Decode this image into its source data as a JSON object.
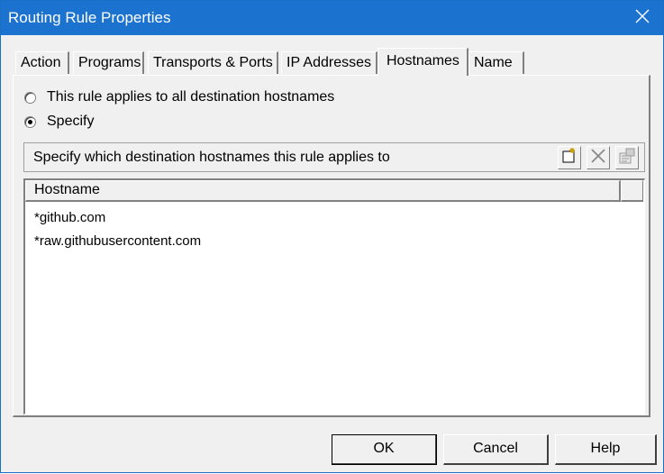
{
  "window": {
    "title": "Routing Rule Properties"
  },
  "tabs": [
    {
      "label": "Action"
    },
    {
      "label": "Programs"
    },
    {
      "label": "Transports & Ports"
    },
    {
      "label": "IP Addresses"
    },
    {
      "label": "Hostnames",
      "active": true
    },
    {
      "label": "Name"
    }
  ],
  "scope": {
    "all_label": "This rule applies to all destination hostnames",
    "specify_label": "Specify",
    "selected": "specify"
  },
  "hostnames_section": {
    "header": "Specify which destination hostnames this rule applies to",
    "tools": [
      "new-icon",
      "delete-icon",
      "properties-icon"
    ]
  },
  "list": {
    "column_header": "Hostname",
    "items": [
      "*github.com",
      "*raw.githubusercontent.com"
    ]
  },
  "buttons": {
    "ok": "OK",
    "cancel": "Cancel",
    "help": "Help"
  },
  "colors": {
    "titlebar": "#1c73cf",
    "face": "#f0f0f0"
  }
}
